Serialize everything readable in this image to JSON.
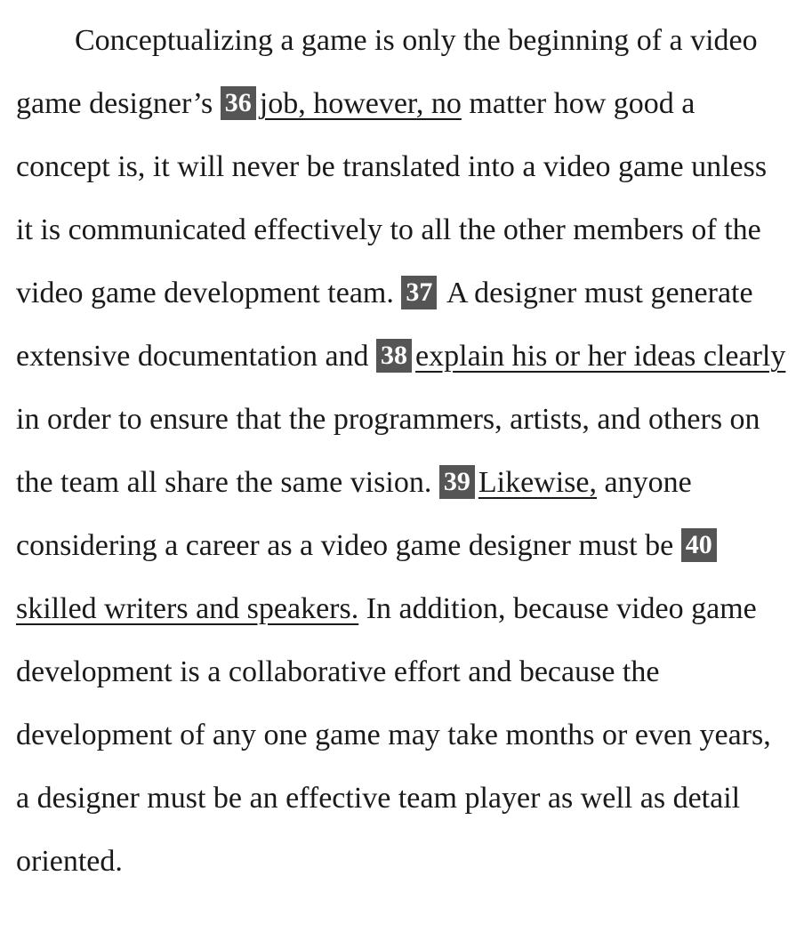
{
  "passage": {
    "t0": "Conceptualizing a game is only the beginning of a video game designer’s ",
    "q36": {
      "num": "36",
      "text": "job, however, no"
    },
    "t1": " matter how good a concept is, it will never be translated into a video game unless it is communicated effectively to all the other members of the video game development team. ",
    "q37": {
      "num": "37"
    },
    "t2": " A designer must generate extensive documentation and ",
    "q38": {
      "num": "38",
      "text": "explain his or her ideas clearly"
    },
    "t3": " in order to ensure that the programmers, artists, and others on the team all share the same vision. ",
    "q39": {
      "num": "39",
      "text": "Likewise,"
    },
    "t4": " anyone considering a career as a video game designer must be ",
    "q40": {
      "num": "40",
      "text": "skilled writers and speakers."
    },
    "t5": " In addition, because video game development is a collaborative effort and because the development of any one game may take months or even years, a designer must be an effective team player as well as detail oriented."
  },
  "colors": {
    "number_badge_bg": "#555555",
    "number_badge_text": "#ffffff",
    "body_text": "#1a1a1a"
  }
}
